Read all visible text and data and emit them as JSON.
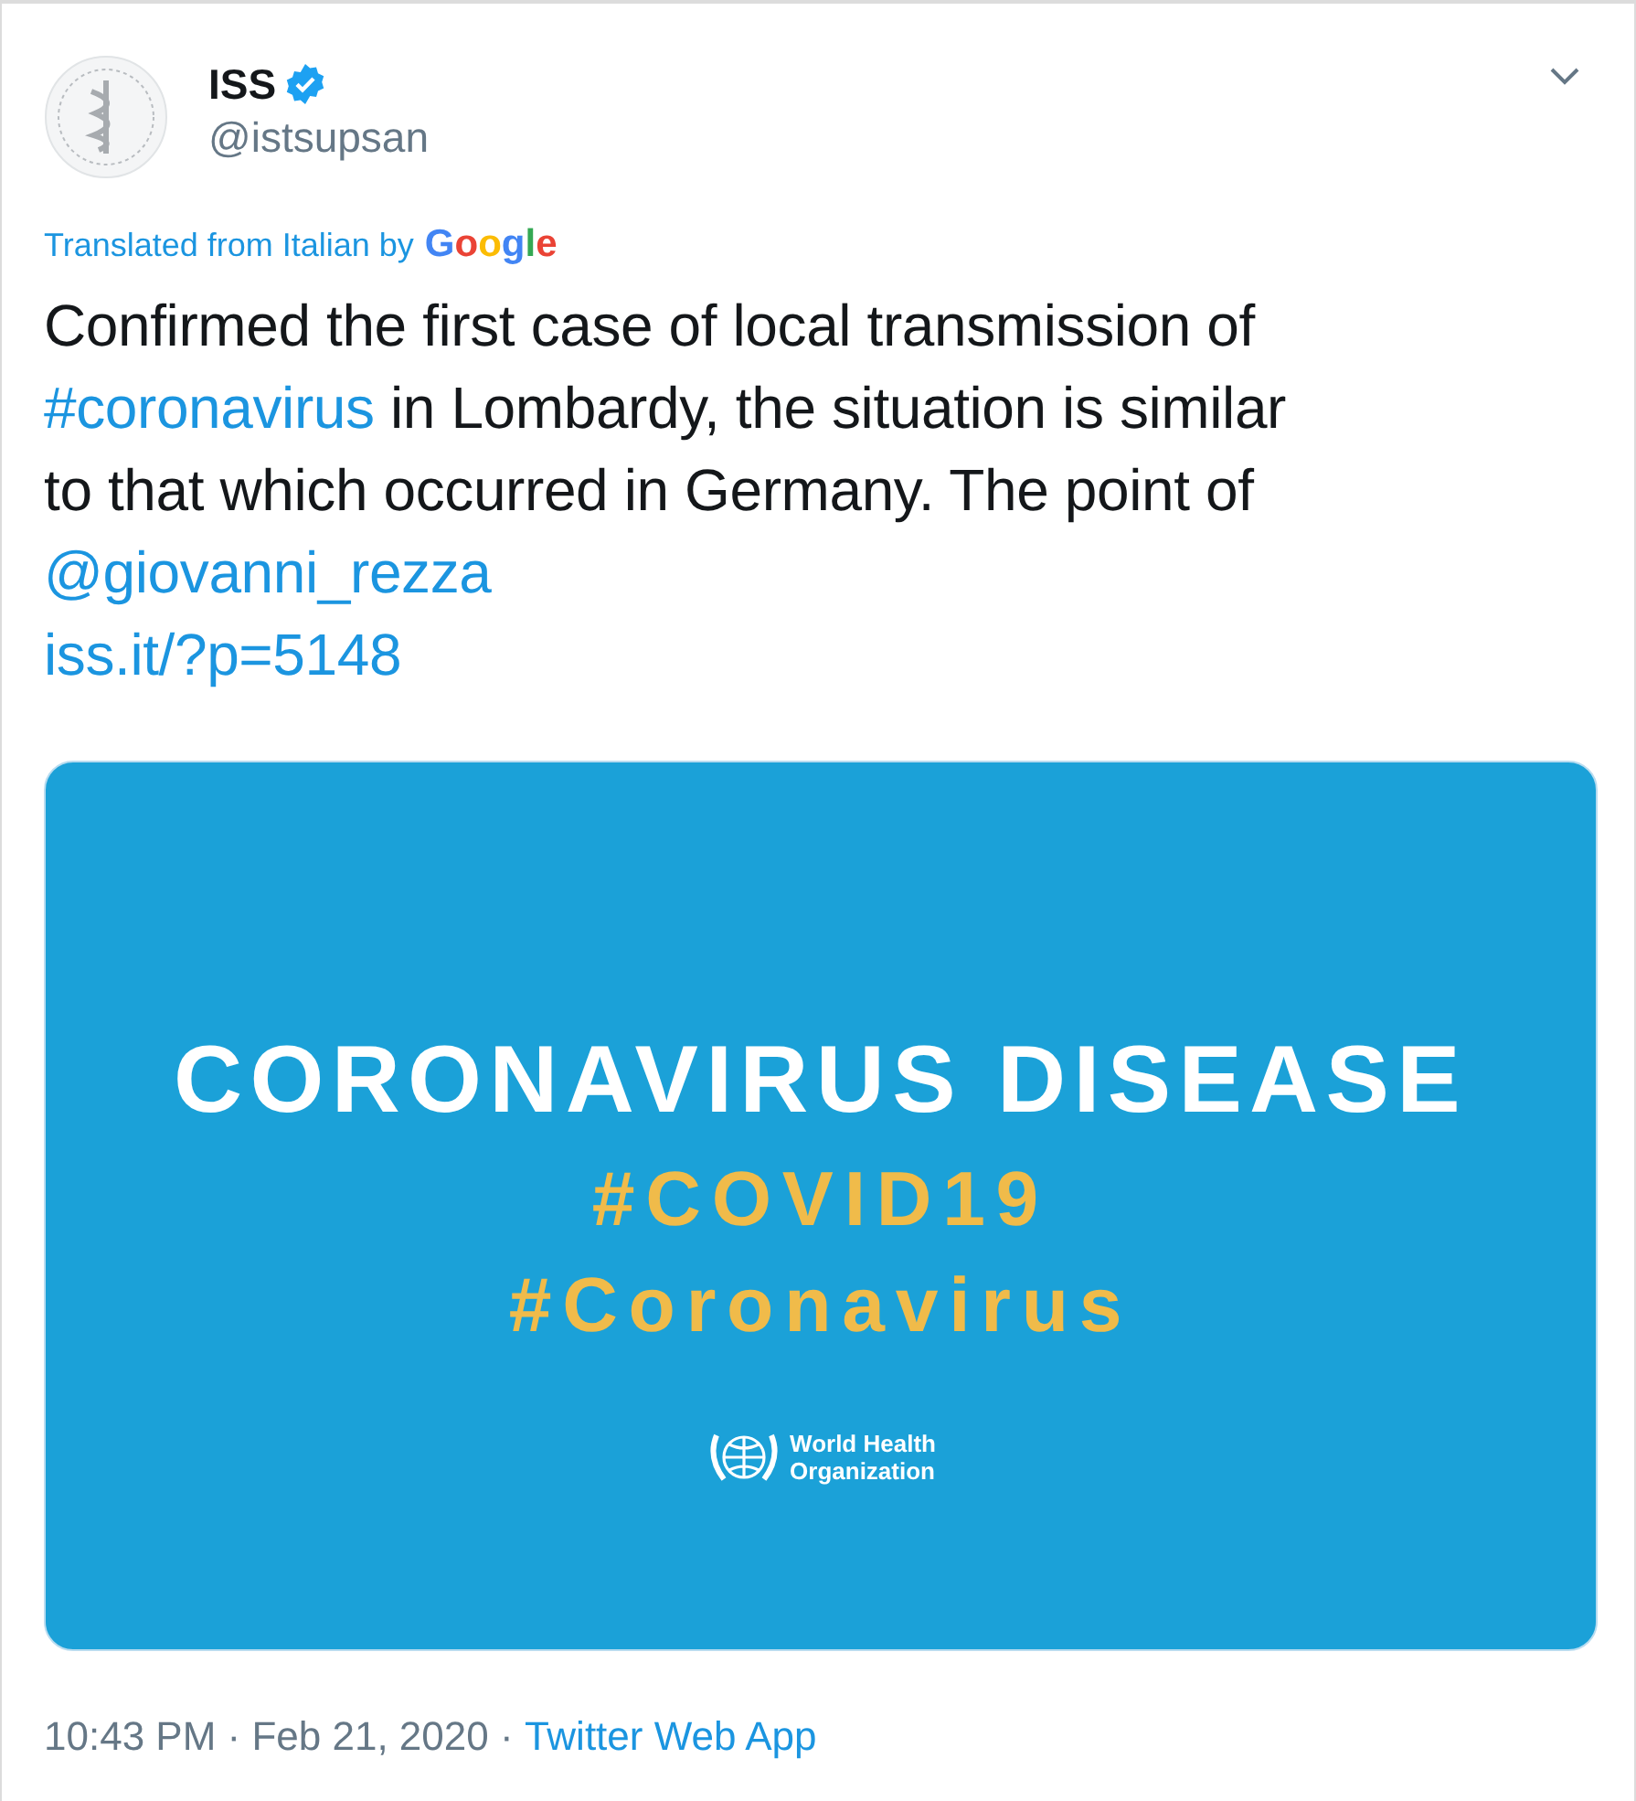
{
  "author": {
    "name": "ISS",
    "verified": true,
    "handle": "@istsupsan"
  },
  "translation": {
    "label": "Translated from Italian by",
    "provider": "Google"
  },
  "tweet_lines": [
    [
      {
        "kind": "text",
        "text": "Confirmed the first case of local transmission of"
      }
    ],
    [
      {
        "kind": "hashtag",
        "text": "#coronavirus"
      },
      {
        "kind": "text",
        "text": " in Lombardy, the situation is similar"
      }
    ],
    [
      {
        "kind": "text",
        "text": "to that which occurred in Germany. The point of"
      }
    ],
    [
      {
        "kind": "mention",
        "text": "@giovanni_rezza"
      }
    ],
    [
      {
        "kind": "link",
        "text": "iss.it/?p=5148"
      }
    ]
  ],
  "media": {
    "title": "CORONAVIRUS DISEASE",
    "hashtags": [
      "#COVID19",
      "#Coronavirus"
    ],
    "org": [
      "World Health",
      "Organization"
    ]
  },
  "footer": {
    "time": "10:43 PM · Feb 21, 2020 · ",
    "source": "Twitter Web App"
  }
}
